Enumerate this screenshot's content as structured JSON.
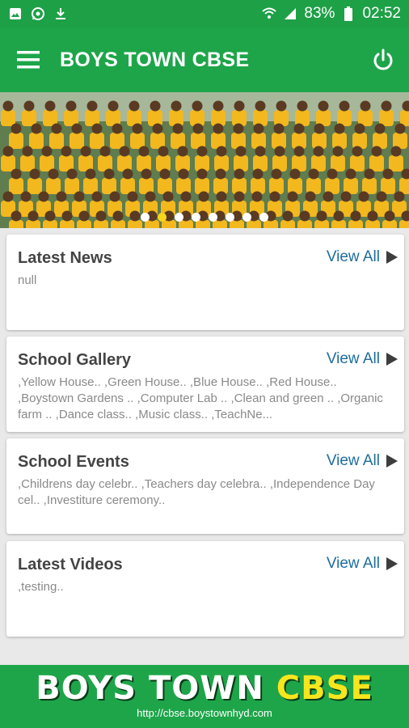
{
  "statusbar": {
    "battery": "83%",
    "time": "02:52"
  },
  "appbar": {
    "title": "BOYS TOWN CBSE"
  },
  "banner": {
    "slide_count": 8,
    "active_slide": 1
  },
  "cards": [
    {
      "title": "Latest News",
      "body": "null",
      "view_all": "View All"
    },
    {
      "title": "School Gallery",
      "body": ",Yellow House.. ,Green House.. ,Blue House.. ,Red House.. ,Boystown Gardens .. ,Computer Lab .. ,Clean and green .. ,Organic farm .. ,Dance class.. ,Music class.. ,TeachNe...",
      "view_all": "View All"
    },
    {
      "title": "School Events",
      "body": ",Childrens day celebr.. ,Teachers day celebra.. ,Independence Day cel.. ,Investiture ceremony..",
      "view_all": "View All"
    },
    {
      "title": "Latest Videos",
      "body": ",testing..",
      "view_all": "View All"
    }
  ],
  "footer": {
    "brand_part1": "BOYS TOWN ",
    "brand_part2": "CBSE",
    "url": "http://cbse.boystownhyd.com"
  },
  "colors": {
    "primary": "#1ea54a",
    "accent_link": "#1d6d9e",
    "highlight": "#f7e51d"
  }
}
